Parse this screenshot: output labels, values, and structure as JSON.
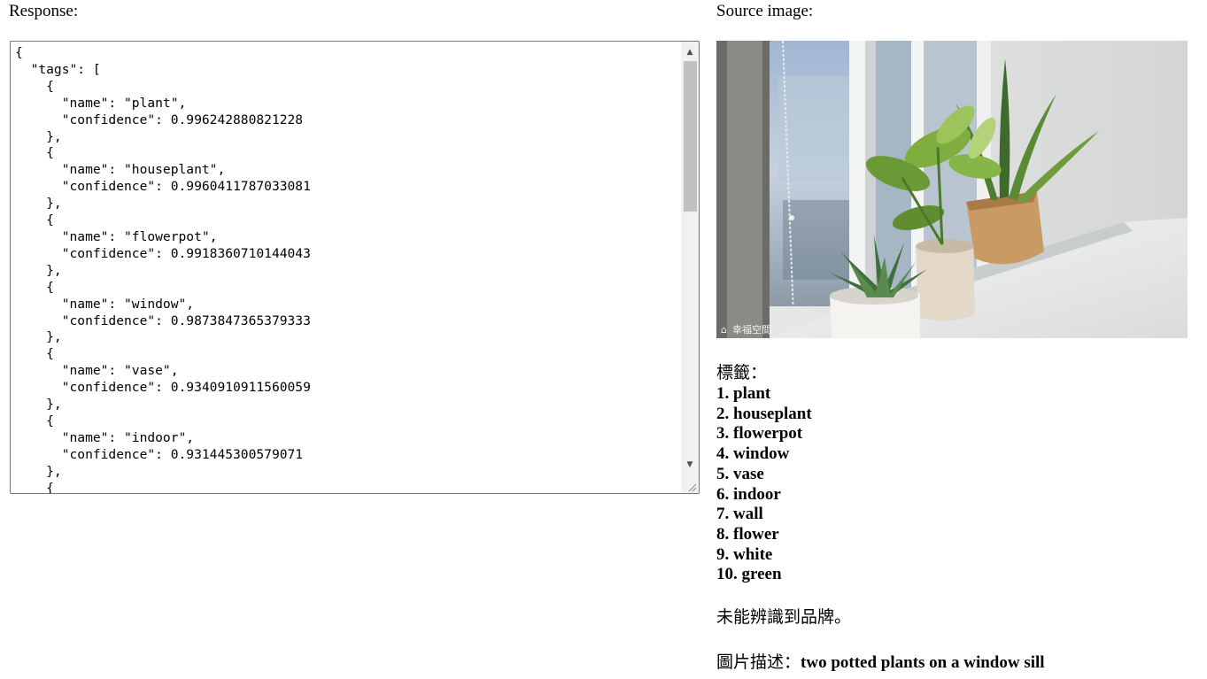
{
  "response_label": "Response:",
  "source_label": "Source image:",
  "response_json_text": "{\n  \"tags\": [\n    {\n      \"name\": \"plant\",\n      \"confidence\": 0.996242880821228\n    },\n    {\n      \"name\": \"houseplant\",\n      \"confidence\": 0.9960411787033081\n    },\n    {\n      \"name\": \"flowerpot\",\n      \"confidence\": 0.9918360710144043\n    },\n    {\n      \"name\": \"window\",\n      \"confidence\": 0.9873847365379333\n    },\n    {\n      \"name\": \"vase\",\n      \"confidence\": 0.9340910911560059\n    },\n    {\n      \"name\": \"indoor\",\n      \"confidence\": 0.931445300579071\n    },\n    {",
  "image_watermark": "幸福空間",
  "tags_heading": "標籤：",
  "tags": [
    "1. plant",
    "2. houseplant",
    "3. flowerpot",
    "4. window",
    "5. vase",
    "6. indoor",
    "7. wall",
    "8. flower",
    "9. white",
    "10. green"
  ],
  "brand_text": "未能辨識到品牌。",
  "caption_label": "圖片描述：",
  "caption_text": "two potted plants on a window sill",
  "icons": {
    "scroll_up": "scroll-up-arrow-icon",
    "scroll_down": "scroll-down-arrow-icon",
    "resize": "resize-grip-icon"
  },
  "colors": {
    "scrollbar_track": "#f1f1f1",
    "scrollbar_thumb": "#c1c1c1",
    "textarea_border": "#767676"
  }
}
